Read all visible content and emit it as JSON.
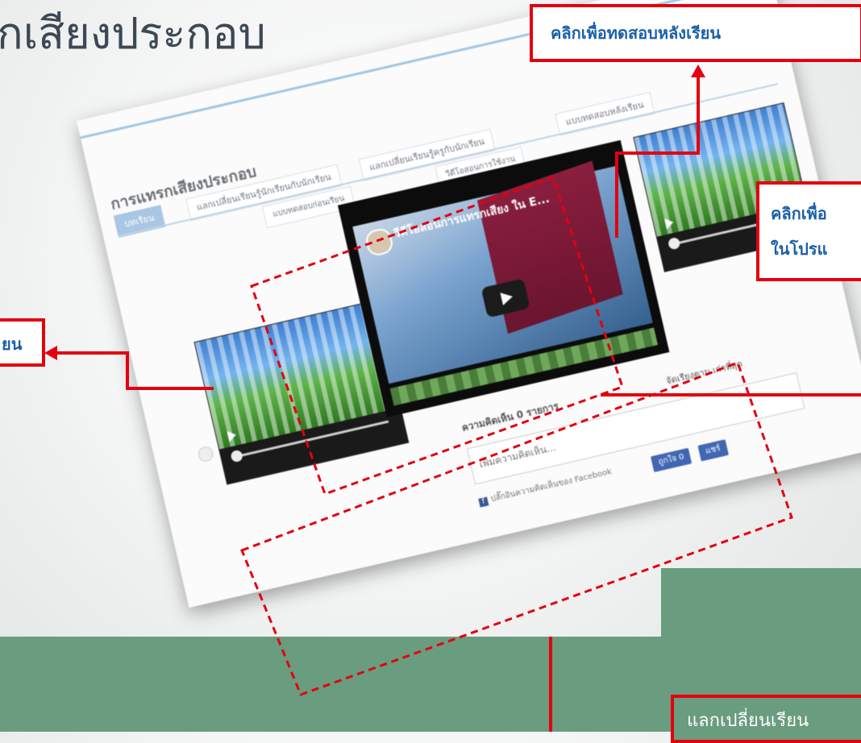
{
  "slide": {
    "title": "กเสียงประกอบ"
  },
  "callouts": {
    "top": "คลิกเพื่อทดสอบหลังเรียน",
    "right_line1": "คลิกเพื่อ",
    "right_line2": "ในโปรแ",
    "left": "ยน",
    "bottom": "แลกเปลี่ยนเรียน"
  },
  "screenshot": {
    "page_title": "การแทรกเสียงประกอบ",
    "tabs": [
      {
        "label": "บทเรียน",
        "active": true
      },
      {
        "label": "แลกเปลี่ยนเรียนรู้นักเรียนกับนักเรียน",
        "active": false
      },
      {
        "label": "แลกเปลี่ยนเรียนรู้ครูกับนักเรียน",
        "active": false
      },
      {
        "label": "แบบทดสอบหลังเรียน",
        "active": false
      }
    ],
    "subtab_left": "แบบทดสอบก่อนเรียน",
    "subtab_mid": "วีดีโอสอนการใช้งาน",
    "video_title": "วีดีโอสอนการแทรกเสียง ใน E...",
    "comments_count": "ความคิดเห็น 0 รายการ",
    "sort_label": "จัดเรียงตาม เก่าที่สุด",
    "comment_placeholder": "เพิ่มความคิดเห็น...",
    "fb_plugin": "ปลั๊กอินความคิดเห็นของ Facebook",
    "like_button": "ถูกใจ 0",
    "share_button": "แชร์"
  },
  "colors": {
    "callout_border": "#e3000f",
    "callout_text": "#1a5fa8",
    "band": "#6a9c7f"
  }
}
